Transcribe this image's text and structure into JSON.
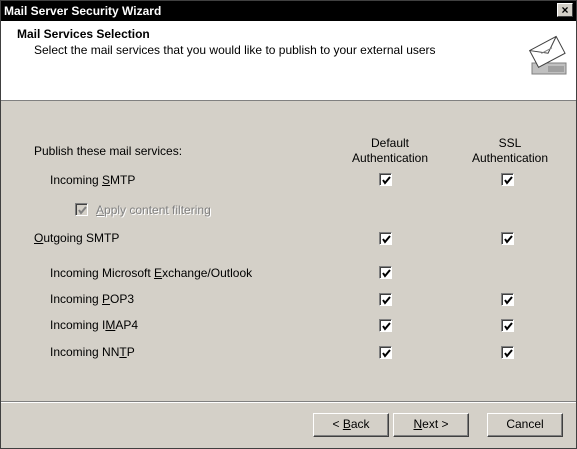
{
  "window": {
    "title": "Mail Server Security Wizard",
    "close_glyph": "×"
  },
  "header": {
    "title": "Mail Services Selection",
    "subtitle": "Select the mail services that you would like to publish to your external users",
    "icon": "wizard-envelope-icon"
  },
  "columns": {
    "section_label": "Publish these mail services:",
    "default_auth": [
      "Default",
      "Authentication"
    ],
    "ssl_auth": [
      "SSL",
      "Authentication"
    ]
  },
  "services": [
    {
      "pre": "Incoming ",
      "key": "S",
      "post": "MTP",
      "default": true,
      "ssl": true
    },
    {
      "pre": "",
      "key": "A",
      "post": "pply content filtering",
      "checked": true,
      "disabled": true
    },
    {
      "pre": "",
      "key": "O",
      "post": "utgoing SMTP",
      "default": true,
      "ssl": true
    },
    {
      "pre": "Incoming Microsoft ",
      "key": "E",
      "post": "xchange/Outlook",
      "default": true,
      "ssl": null
    },
    {
      "pre": "Incoming ",
      "key": "P",
      "post": "OP3",
      "default": true,
      "ssl": true
    },
    {
      "pre": "Incoming I",
      "key": "M",
      "post": "AP4",
      "default": true,
      "ssl": true
    },
    {
      "pre": "Incoming NN",
      "key": "T",
      "post": "P",
      "default": true,
      "ssl": true
    }
  ],
  "buttons": {
    "back": {
      "pre": "< ",
      "key": "B",
      "post": "ack"
    },
    "next": {
      "pre": "",
      "key": "N",
      "post": "ext >"
    },
    "cancel": "Cancel"
  }
}
